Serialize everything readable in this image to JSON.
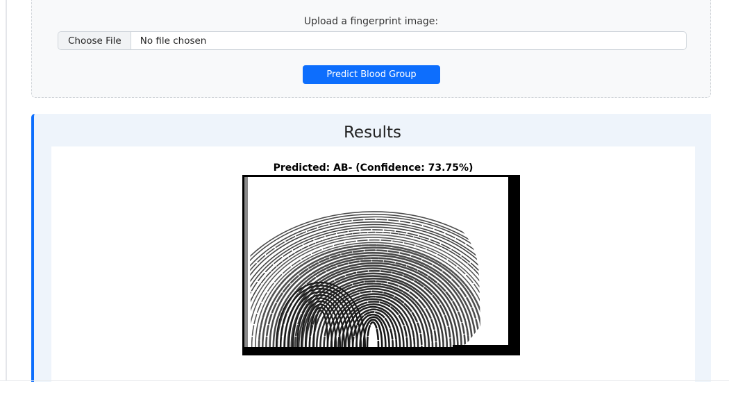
{
  "upload": {
    "label": "Upload a fingerprint image:",
    "choose_file_label": "Choose File",
    "file_status": "No file chosen",
    "predict_button_label": "Predict Blood Group"
  },
  "results": {
    "title": "Results",
    "prediction_text": "Predicted: AB- (Confidence: 73.75%)"
  },
  "colors": {
    "accent": "#0d6efd",
    "results_background": "#eef4fb",
    "upload_background": "#f8f9fa"
  }
}
